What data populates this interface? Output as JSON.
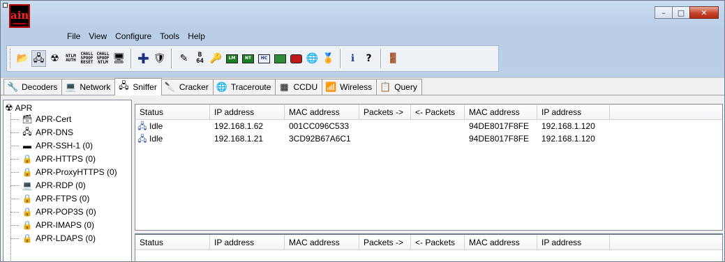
{
  "app": {
    "logo_text": "ain"
  },
  "window_controls": {
    "minimize": "–",
    "maximize": "□",
    "close": "✕"
  },
  "menu": [
    "File",
    "View",
    "Configure",
    "Tools",
    "Help"
  ],
  "toolbar": {
    "icons": [
      "open-folder-icon",
      "network-card-icon",
      "radiation-icon",
      "ntlm-auth-icon",
      "chall-spoof-reset-icon",
      "chall-spoof-ntlm-icon",
      "monitor-icon",
      "add-icon",
      "shield-icon",
      "edit-icon",
      "b64-icon",
      "key-icon",
      "lm-icon",
      "hash-icon",
      "hc-icon",
      "chip-icon",
      "red-chip-icon",
      "globe-icon",
      "cert-icon",
      "info-icon",
      "help-icon",
      "exit-icon"
    ],
    "labels": {
      "ntlm_auth": "NTLM AUTH",
      "chall_spoof_reset": "CHALL SPOOF RESET",
      "chall_spoof_ntlm": "CHALL SPOOF NTLM",
      "b64": "B 64"
    }
  },
  "tabs": [
    {
      "label": "Decoders",
      "icon": "decoder-icon",
      "active": false
    },
    {
      "label": "Network",
      "icon": "network-icon",
      "active": false
    },
    {
      "label": "Sniffer",
      "icon": "sniffer-icon",
      "active": true
    },
    {
      "label": "Cracker",
      "icon": "cracker-icon",
      "active": false
    },
    {
      "label": "Traceroute",
      "icon": "traceroute-icon",
      "active": false
    },
    {
      "label": "CCDU",
      "icon": "ccdu-icon",
      "active": false
    },
    {
      "label": "Wireless",
      "icon": "wireless-icon",
      "active": false
    },
    {
      "label": "Query",
      "icon": "query-icon",
      "active": false
    }
  ],
  "tree": {
    "root": "APR",
    "items": [
      {
        "label": "APR-Cert",
        "icon": "certificate-icon"
      },
      {
        "label": "APR-DNS",
        "icon": "dns-icon"
      },
      {
        "label": "APR-SSH-1 (0)",
        "icon": "terminal-icon"
      },
      {
        "label": "APR-HTTPS (0)",
        "icon": "lock-icon"
      },
      {
        "label": "APR-ProxyHTTPS (0)",
        "icon": "lock-icon"
      },
      {
        "label": "APR-RDP (0)",
        "icon": "rdp-icon"
      },
      {
        "label": "APR-FTPS (0)",
        "icon": "lock-icon"
      },
      {
        "label": "APR-POP3S (0)",
        "icon": "lock-icon"
      },
      {
        "label": "APR-IMAPS (0)",
        "icon": "lock-icon"
      },
      {
        "label": "APR-LDAPS (0)",
        "icon": "lock-icon"
      }
    ]
  },
  "top_table": {
    "columns": [
      "Status",
      "IP address",
      "MAC address",
      "Packets ->",
      "<- Packets",
      "MAC address",
      "IP address"
    ],
    "rows": [
      [
        "Idle",
        "192.168.1.62",
        "001CC096C533",
        "",
        "",
        "94DE8017F8FE",
        "192.168.1.120"
      ],
      [
        "Idle",
        "192.168.1.21",
        "3CD92B67A6C1",
        "",
        "",
        "94DE8017F8FE",
        "192.168.1.120"
      ]
    ]
  },
  "bottom_table": {
    "columns": [
      "Status",
      "IP address",
      "MAC address",
      "Packets ->",
      "<- Packets",
      "MAC address",
      "IP address"
    ]
  },
  "colors": {
    "titlebar": "#bcd2ea",
    "logo_red": "#c00000",
    "close_red": "#c8432c"
  }
}
